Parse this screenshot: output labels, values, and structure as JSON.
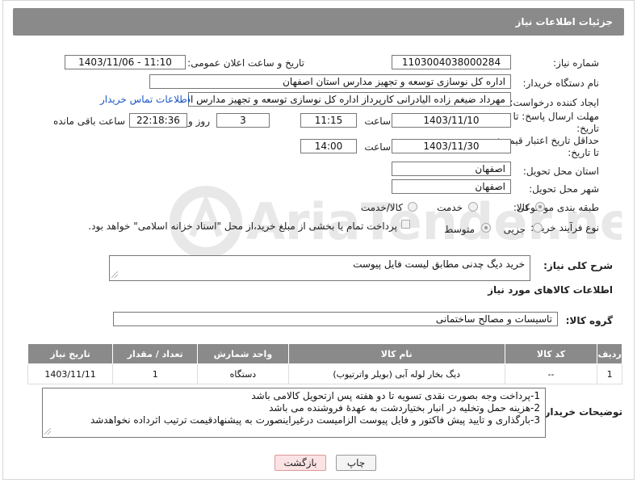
{
  "header": {
    "title": "جزئیات اطلاعات نیاز"
  },
  "watermark": {
    "text": "AriaTender.neT"
  },
  "fields": {
    "need_number_label": "شماره نیاز:",
    "need_number": "1103004038000284",
    "announce_label": "تاریخ و ساعت اعلان عمومی:",
    "announce_value": "1403/11/06 - 11:10",
    "buyer_label": "نام دستگاه خریدار:",
    "buyer_value": "اداره کل نوسازی  توسعه و تجهیز مدارس استان اصفهان",
    "creator_label": "ایجاد کننده درخواست:",
    "creator_value": "مهرداد ضیغم زاده الیادرانی کارپرداز اداره کل نوسازی  توسعه و تجهیز مدارس اس",
    "contact_link": "اطلاعات تماس خریدار",
    "reply_deadline_label": "مهلت ارسال پاسخ: تا تاریخ:",
    "reply_date": "1403/11/10",
    "time_label": "ساعت",
    "reply_time": "11:15",
    "days_value": "3",
    "days_label": "روز و",
    "remaining_value": "22:18:36",
    "remaining_label": "ساعت باقی مانده",
    "validity_label": "حداقل تاریخ اعتبار قیمت: تا تاریخ:",
    "validity_date": "1403/11/30",
    "validity_time_label": "ساعت",
    "validity_time": "14:00",
    "province_label": "استان محل تحویل:",
    "province_value": "اصفهان",
    "city_label": "شهر محل تحویل:",
    "city_value": "اصفهان",
    "category_label": "طبقه بندی موضوعی:",
    "category_options": [
      "کالا",
      "خدمت",
      "کالا/خدمت"
    ],
    "purchase_label": "نوع فرآیند خرید :",
    "purchase_options": [
      "جزیی",
      "متوسط"
    ],
    "purchase_note": "پرداخت تمام یا بخشی از مبلغ خرید،از محل \"اسناد خزانه اسلامی\" خواهد بود."
  },
  "description": {
    "label": "شرح کلی نیاز:",
    "value": "خرید دیگ چدنی مطابق لیست فایل پیوست"
  },
  "goods_section": {
    "title": "اطلاعات کالاهای مورد نیاز",
    "group_label": "گروه کالا:",
    "group_value": "تاسیسات و مصالح ساختمانی"
  },
  "table": {
    "headers": [
      "ردیف",
      "کد کالا",
      "نام کالا",
      "واحد شمارش",
      "تعداد / مقدار",
      "تاریخ نیاز"
    ],
    "rows": [
      [
        "1",
        "--",
        "دیگ بخار لوله آبی (بویلر واترتیوب)",
        "دستگاه",
        "1",
        "1403/11/11"
      ]
    ]
  },
  "buyer_notes": {
    "label": "توضیحات خریدار:",
    "lines": [
      "1-پرداخت وجه بصورت نقدی تسویه تا دو هفته پس ازتحویل کالامی باشد",
      "2-هزینه حمل وتخلیه در انبار بختیاردشت به عهدهٔ فروشنده می باشد",
      "3-بارگذاری و تایید پیش فاکتور و فایل پیوست الزامیست درغیراینصورت به پیشنهادقیمت ترتیب اثرداده نخواهدشد"
    ]
  },
  "buttons": {
    "print": "چاپ",
    "back": "بازگشت"
  },
  "colors": {
    "header_bg": "#8a8a8a",
    "link": "#1a56c4",
    "back_button_bg": "#fbe3e3"
  }
}
